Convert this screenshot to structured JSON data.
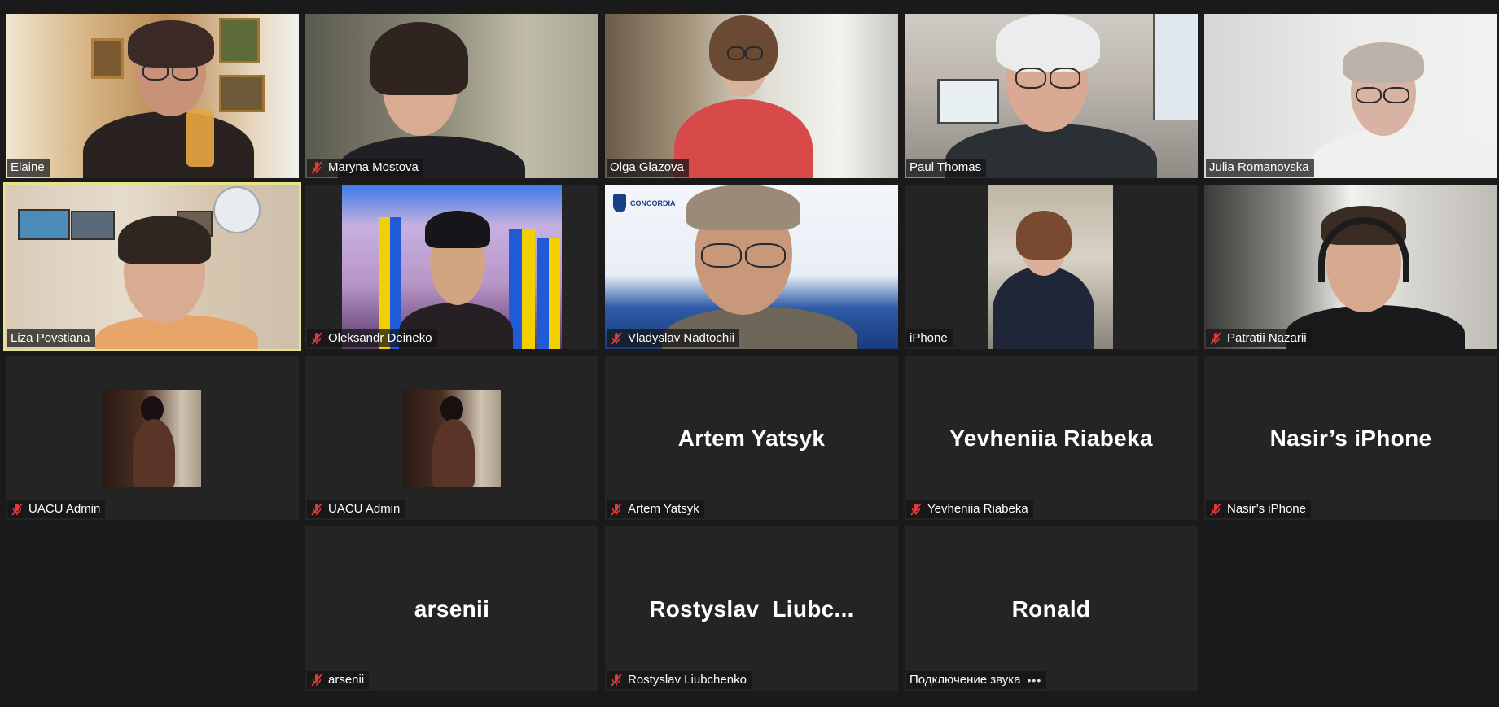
{
  "meeting": {
    "participants": [
      {
        "name": "Elaine",
        "muted": false,
        "active": false
      },
      {
        "name": "Maryna Mostova",
        "muted": true,
        "active": false
      },
      {
        "name": "Olga Glazova",
        "muted": false,
        "active": false
      },
      {
        "name": "Paul Thomas",
        "muted": false,
        "active": false
      },
      {
        "name": "Julia Romanovska",
        "muted": false,
        "active": false
      },
      {
        "name": "Liza Povstiana",
        "muted": false,
        "active": true
      },
      {
        "name": "Oleksandr Deineko",
        "muted": true,
        "active": false
      },
      {
        "name": "Vladyslav Nadtochii",
        "muted": true,
        "active": false
      },
      {
        "name": "iPhone",
        "muted": false,
        "active": false
      },
      {
        "name": "Patratii Nazarii",
        "muted": true,
        "active": false
      },
      {
        "name": "UACU Admin",
        "muted": true,
        "active": false
      },
      {
        "name": "UACU Admin",
        "muted": true,
        "active": false
      },
      {
        "name": "Artem Yatsyk",
        "display": "Artem Yatsyk",
        "muted": true,
        "active": false
      },
      {
        "name": "Yevheniia Riabeka",
        "display": "Yevheniia Riabeka",
        "muted": true,
        "active": false
      },
      {
        "name": "Nasir’s iPhone",
        "display": "Nasir’s iPhone",
        "muted": true,
        "active": false
      },
      {
        "name": "arsenii",
        "display": "arsenii",
        "muted": true,
        "active": false
      },
      {
        "name": "Rostyslav Liubchenko",
        "display": "Rostyslav  Liubc...",
        "muted": true,
        "active": false
      },
      {
        "name": "Подключение звука",
        "display": "Ronald",
        "muted": false,
        "active": false,
        "more": "•••"
      }
    ],
    "logo_text": "CONCORDIA",
    "colors": {
      "background": "#1a1a1a",
      "tile": "#242424",
      "active_border": "#e5e28a",
      "mute_icon": "#e03a3a"
    }
  }
}
